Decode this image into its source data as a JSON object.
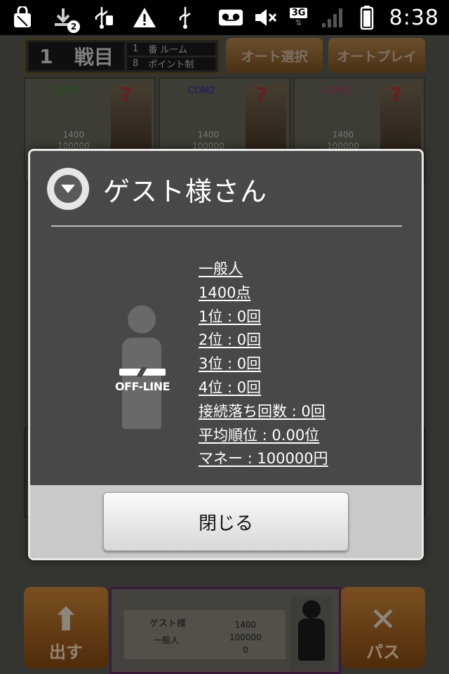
{
  "status_bar": {
    "time": "8:38",
    "network": "3G",
    "notification_badge": "2",
    "icons": [
      "shopping-bag-icon",
      "download-icon",
      "usb-icon",
      "warning-icon",
      "usb-icon",
      "voicemail-icon",
      "mute-icon",
      "signal-icon",
      "battery-icon"
    ]
  },
  "game": {
    "round_number": "1",
    "round_label": "戦目",
    "room_number": "1",
    "room_label": "番 ルーム",
    "points_number": "8",
    "points_label": "ポイント制",
    "auto_select_label": "オート選択",
    "auto_play_label": "オートプレイ",
    "opponents": [
      {
        "name": "COM1",
        "points": "1400",
        "money": "100000",
        "color": "#2a9a2a"
      },
      {
        "name": "COM2",
        "points": "1400",
        "money": "100000",
        "color": "#2a2ab8"
      },
      {
        "name": "COM3",
        "points": "1400",
        "money": "100000",
        "color": "#c0306a"
      }
    ],
    "play_button_label": "出す",
    "pass_button_label": "パス",
    "player": {
      "name": "ゲスト様",
      "rank": "一般人",
      "points": "1400",
      "money": "100000",
      "extra": "0",
      "status": "OFF-LINE"
    }
  },
  "dialog": {
    "title": "ゲスト様さん",
    "icon": "chevron-down-icon",
    "connection_status": "OFF-LINE",
    "info": [
      "一般人",
      "1400点",
      "1位 : 0回",
      "2位 : 0回",
      "3位 : 0回",
      "4位 : 0回",
      "接続落ち回数 : 0回",
      "平均順位 : 0.00位",
      "マネー : 100000円"
    ],
    "close_label": "閉じる"
  }
}
